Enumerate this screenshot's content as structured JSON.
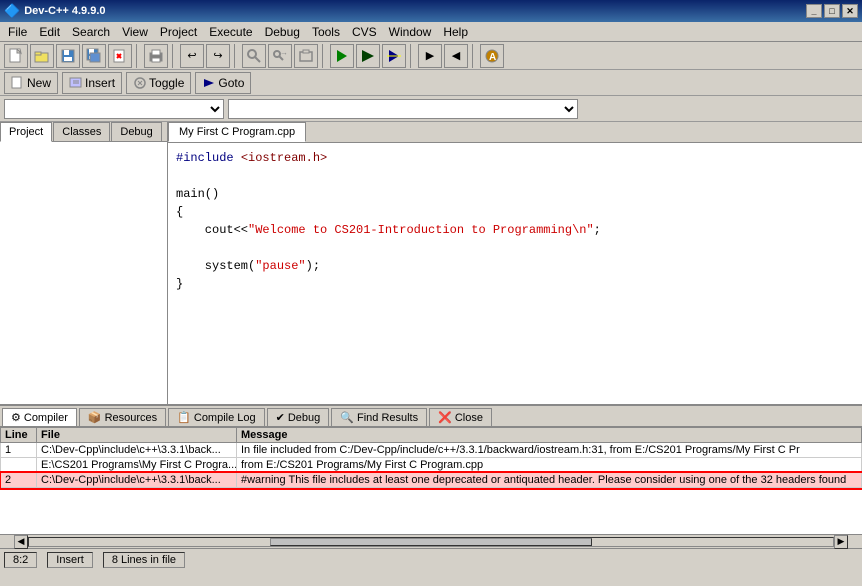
{
  "titlebar": {
    "title": "Dev-C++ 4.9.9.0",
    "icon": "🔷",
    "buttons": [
      "_",
      "□",
      "✕"
    ]
  },
  "menubar": {
    "items": [
      "File",
      "Edit",
      "Search",
      "View",
      "Project",
      "Execute",
      "Debug",
      "Tools",
      "CVS",
      "Window",
      "Help"
    ]
  },
  "toolbar1": {
    "buttons": [
      {
        "name": "new-file-btn",
        "icon": "📄"
      },
      {
        "name": "open-btn",
        "icon": "📂"
      },
      {
        "name": "save-btn",
        "icon": "💾"
      },
      {
        "name": "save-all-btn",
        "icon": "💾"
      },
      {
        "name": "close-btn",
        "icon": "✖"
      },
      {
        "name": "print-btn",
        "icon": "🖨"
      },
      {
        "name": "undo-btn",
        "icon": "↩"
      },
      {
        "name": "redo-btn",
        "icon": "↪"
      },
      {
        "name": "find-btn",
        "icon": "🔍"
      },
      {
        "name": "replace-btn",
        "icon": "🔄"
      },
      {
        "name": "go-btn",
        "icon": "▶"
      },
      {
        "name": "compile-btn",
        "icon": "⚙"
      },
      {
        "name": "run-btn",
        "icon": "▶"
      },
      {
        "name": "debug-btn",
        "icon": "🐛"
      },
      {
        "name": "settings-btn",
        "icon": "⚙"
      },
      {
        "name": "about-btn",
        "icon": "ℹ"
      }
    ]
  },
  "toolbar2": {
    "items": [
      {
        "name": "new-item-btn",
        "icon": "◻",
        "label": "New"
      },
      {
        "name": "insert-btn",
        "icon": "📋",
        "label": "Insert"
      },
      {
        "name": "toggle-btn",
        "icon": "🔔",
        "label": "Toggle"
      },
      {
        "name": "goto-btn",
        "icon": "🚀",
        "label": "Goto"
      }
    ]
  },
  "combobar": {
    "left_placeholder": "",
    "right_placeholder": ""
  },
  "left_tabs": {
    "items": [
      "Project",
      "Classes",
      "Debug"
    ],
    "active": 0
  },
  "editor": {
    "tab": "My First C Program.cpp",
    "code": [
      {
        "text": "#include <iostream.h>",
        "type": "include"
      },
      {
        "text": "",
        "type": "blank"
      },
      {
        "text": "main()",
        "type": "normal"
      },
      {
        "text": "{",
        "type": "normal"
      },
      {
        "text": "    cout<<\"Welcome to CS201-Introduction to Programming\\n\";",
        "type": "cout"
      },
      {
        "text": "",
        "type": "blank"
      },
      {
        "text": "    system(\"pause\");",
        "type": "system"
      },
      {
        "text": "}",
        "type": "normal"
      }
    ]
  },
  "bottom_panel": {
    "tabs": [
      {
        "name": "compiler-tab",
        "icon": "⚙",
        "label": "Compiler"
      },
      {
        "name": "resources-tab",
        "icon": "📦",
        "label": "Resources"
      },
      {
        "name": "compile-log-tab",
        "icon": "📋",
        "label": "Compile Log"
      },
      {
        "name": "debug-tab",
        "icon": "✔",
        "label": "Debug"
      },
      {
        "name": "find-results-tab",
        "icon": "🔍",
        "label": "Find Results"
      },
      {
        "name": "close-tab",
        "icon": "❌",
        "label": "Close"
      }
    ],
    "active": 0,
    "columns": [
      "Line",
      "File",
      "Message"
    ],
    "rows": [
      {
        "line": "1",
        "file": "C:\\Dev-Cpp\\include\\c++\\3.3.1\\back...",
        "message": "In file included from C:/Dev-Cpp/include/c++/3.3.1/backward/iostream.h:31,    from E:/CS201 Programs/My First C Pr",
        "selected": false
      },
      {
        "line": "",
        "file": "E:\\CS201 Programs\\My First C Progra...",
        "message": "from E:/CS201 Programs/My First C Program.cpp",
        "selected": false
      },
      {
        "line": "2",
        "file": "C:\\Dev-Cpp\\include\\c++\\3.3.1\\back...",
        "message": "#warning This file includes at least one deprecated or antiquated header. Please consider using one of the 32 headers found",
        "selected": true
      }
    ]
  },
  "statusbar": {
    "position": "8:2",
    "mode": "Insert",
    "lines": "8 Lines in file"
  }
}
